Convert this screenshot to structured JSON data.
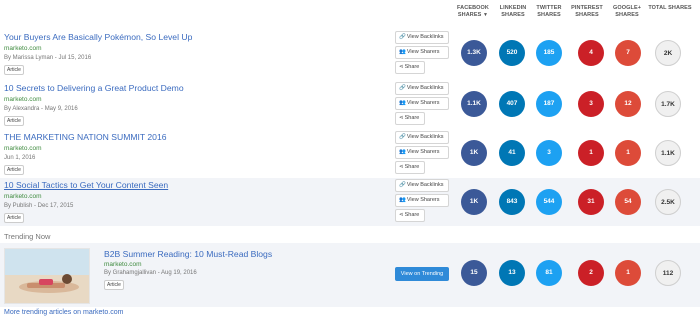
{
  "columns": [
    {
      "line1": "FACEBOOK",
      "line2": "SHARES",
      "sort": "▼"
    },
    {
      "line1": "LINKEDIN",
      "line2": "SHARES",
      "sort": ""
    },
    {
      "line1": "TWITTER",
      "line2": "SHARES",
      "sort": ""
    },
    {
      "line1": "PINTEREST",
      "line2": "SHARES",
      "sort": ""
    },
    {
      "line1": "GOOGLE+",
      "line2": "SHARES",
      "sort": ""
    },
    {
      "line1": "TOTAL SHARES",
      "line2": "",
      "sort": ""
    }
  ],
  "actions": {
    "backlinks": "View Backlinks",
    "sharers": "View Sharers",
    "share": "Share"
  },
  "articles": [
    {
      "title": "Your Buyers Are Basically Pokémon, So Level Up",
      "domain": "marketo.com",
      "meta": "By Marissa Lyman - Jul 15, 2016",
      "tag": "Article",
      "facebook": "1.3K",
      "linkedin": "520",
      "twitter": "185",
      "pinterest": "4",
      "googleplus": "7",
      "total": "2K"
    },
    {
      "title": "10 Secrets to Delivering a Great Product Demo",
      "domain": "marketo.com",
      "meta": "By Alexandra - May 9, 2016",
      "tag": "Article",
      "facebook": "1.1K",
      "linkedin": "407",
      "twitter": "187",
      "pinterest": "3",
      "googleplus": "12",
      "total": "1.7K"
    },
    {
      "title": "THE MARKETING NATION SUMMIT 2016",
      "domain": "marketo.com",
      "meta": "Jun 1, 2016",
      "tag": "Article",
      "facebook": "1K",
      "linkedin": "41",
      "twitter": "3",
      "pinterest": "1",
      "googleplus": "1",
      "total": "1.1K"
    },
    {
      "title": "10 Social Tactics to Get Your Content Seen",
      "domain": "marketo.com",
      "meta": "By Publish - Dec 17, 2015",
      "tag": "Article",
      "facebook": "1K",
      "linkedin": "843",
      "twitter": "544",
      "pinterest": "31",
      "googleplus": "54",
      "total": "2.5K"
    }
  ],
  "trending": {
    "label": "Trending Now",
    "title": "B2B Summer Reading: 10 Must-Read Blogs",
    "domain": "marketo.com",
    "meta": "By Grahamgjallivan - Aug 19, 2016",
    "tag": "Article",
    "button": "View on Trending",
    "facebook": "15",
    "linkedin": "13",
    "twitter": "81",
    "pinterest": "2",
    "googleplus": "1",
    "total": "112"
  },
  "more_link": "More trending articles on marketo.com",
  "colors": {
    "facebook": "#3b5998",
    "linkedin": "#0077b5",
    "twitter": "#1da1f2",
    "pinterest": "#cb2027",
    "googleplus": "#dd4b39",
    "link": "#3b6bbf",
    "domain": "#3f8b3f"
  }
}
